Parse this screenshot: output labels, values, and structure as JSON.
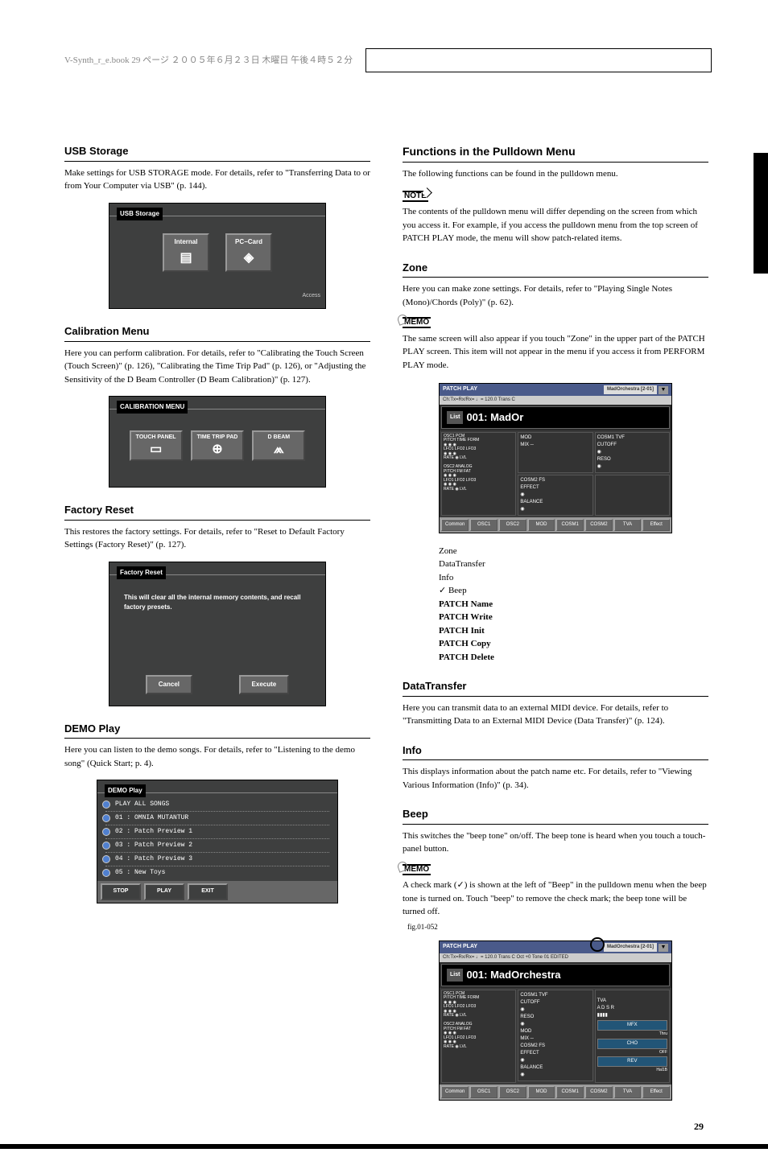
{
  "header": {
    "page_info": "V-Synth_r_e.book 29 ページ ２００５年６月２３日 木曜日 午後４時５２分"
  },
  "left": {
    "usb": {
      "heading": "USB Storage",
      "desc": "Make settings for USB STORAGE mode. For details, refer to \"Transferring Data to or from Your Computer via USB\" (p. 144).",
      "title": "USB Storage",
      "btn1": "Internal",
      "btn2": "PC−Card",
      "access": "Access"
    },
    "cal": {
      "heading": "Calibration Menu",
      "desc": "Here you can perform calibration. For details, refer to \"Calibrating the Touch Screen (Touch Screen)\" (p. 126), \"Calibrating the Time Trip Pad\" (p. 126), or \"Adjusting the Sensitivity of the D Beam Controller (D Beam Calibration)\" (p. 127).",
      "title": "CALIBRATION MENU",
      "btn1": "TOUCH PANEL",
      "btn2": "TIME TRIP PAD",
      "btn3": "D BEAM"
    },
    "factory": {
      "heading": "Factory Reset",
      "desc": "This restores the factory settings. For details, refer to \"Reset to Default Factory Settings (Factory Reset)\" (p. 127).",
      "title": "Factory Reset",
      "body": "This will clear all the internal memory contents, and recall factory presets.",
      "cancel": "Cancel",
      "execute": "Execute"
    },
    "demo": {
      "heading": "DEMO Play",
      "desc": "Here you can listen to the demo songs. For details, refer to \"Listening to the demo song\" (Quick Start; p. 4).",
      "title": "DEMO Play",
      "rows": [
        "PLAY ALL SONGS",
        "01 : OMNIA MUTANTUR",
        "02 : Patch Preview 1",
        "03 : Patch Preview 2",
        "04 : Patch Preview 3",
        "05 : New Toys"
      ],
      "stop": "STOP",
      "play": "PLAY",
      "exit": "EXIT"
    }
  },
  "right": {
    "fns": {
      "heading": "Functions in the Pulldown Menu",
      "intro": "The following functions can be found in the pulldown menu.",
      "note_label": "NOTE",
      "note_text": "The contents of the pulldown menu will differ depending on the screen from which you access it. For example, if you access the pulldown menu from the top screen of PATCH PLAY mode, the menu will show patch-related items.",
      "zone_heading": "Zone",
      "zone_desc": "Here you can make zone settings. For details, refer to \"Playing Single Notes (Mono)/Chords (Poly)\" (p. 62).",
      "memo_label": "MEMO",
      "memo_text": "The same screen will also appear if you touch \"Zone\" in the upper part of the PATCH PLAY screen. This item will not appear in the menu if you access it from PERFORM PLAY mode."
    },
    "synth1": {
      "title": "PATCH PLAY",
      "patch_label": "MadOrchestra [2-01]",
      "sub": "Ch:Tx=Rx/Rx=  ♩= 120.0  Trans  C",
      "patch": "001: MadOr",
      "list": "List",
      "menu": [
        "Zone",
        "DataTransfer",
        "Info",
        "✓ Beep",
        "PATCH Name",
        "PATCH Write",
        "PATCH Init",
        "PATCH Copy",
        "PATCH Delete"
      ],
      "tabs": [
        "Common",
        "OSC1",
        "OSC2",
        "MOD",
        "COSM1",
        "COSM2",
        "TVA",
        "Effect"
      ]
    },
    "datatrans": {
      "heading": "DataTransfer",
      "desc": "Here you can transmit data to an external MIDI device. For details, refer to \"Transmitting Data to an External MIDI Device (Data Transfer)\" (p. 124).",
      "info_heading": "Info",
      "info_desc": "This displays information about the patch name etc. For details, refer to \"Viewing Various Information (Info)\" (p. 34).",
      "beep_heading": "Beep",
      "beep_desc": "This switches the \"beep tone\" on/off. The beep tone is heard when you touch a touch-panel button.",
      "memo_label": "MEMO",
      "memo_text": "A check mark (✓) is shown at the left of \"Beep\" in the pulldown menu when the beep tone is turned on. Touch \"beep\" to remove the check mark; the beep tone will be turned off.",
      "fig_label": "fig.01-052"
    },
    "synth2": {
      "title": "PATCH PLAY",
      "patch_label": "MadOrchestra [2-01]",
      "sub": "Ch:Tx=Rx/Rx=  ♩= 120.0  Trans  C  Oct +0  Tone 01  EDITED",
      "patch": "001: MadOrchestra",
      "list": "List",
      "tabs": [
        "Common",
        "OSC1",
        "OSC2",
        "MOD",
        "COSM1",
        "COSM2",
        "TVA",
        "Effect"
      ],
      "efx": [
        "MFX",
        "Thru",
        "CHO",
        "OFF",
        "REV",
        "Hal1B"
      ]
    }
  },
  "page_number": "29"
}
